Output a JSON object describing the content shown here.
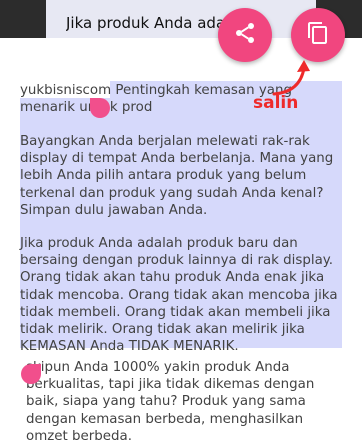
{
  "background_page": {
    "title_snippet": "Jika produk Anda adalah produk baru"
  },
  "article": {
    "p1": "yukbisniscom Pentingkah kemasan yang menarik untuk prod",
    "p2": "Bayangkan Anda berjalan melewati rak-rak display di tempat Anda berbelanja. Mana yang lebih Anda pilih antara produk yang belum terkenal dan produk yang sudah Anda kenal? Simpan dulu jawaban Anda.",
    "p3": "Jika produk Anda adalah produk baru dan bersaing dengan produk lainnya di rak display. Orang tidak akan tahu produk Anda enak jika tidak mencoba. Orang tidak akan mencoba jika tidak membeli. Orang tidak akan membeli jika tidak melirik. Orang tidak akan melirik jika KEMASAN Anda TIDAK MENARIK.",
    "p4": "skipun Anda 1000% yakin produk Anda berkualitas, tapi jika tidak dikemas dengan baik, siapa yang tahu? Produk yang sama dengan kemasan berbeda, menghasilkan omzet berbeda."
  },
  "actions": {
    "share_icon": "share-icon",
    "copy_icon": "copy-icon",
    "annotation": "salin"
  },
  "colors": {
    "accent": "#f1467f",
    "selection": "#d6d9fb",
    "annotation": "#ee2a2a"
  }
}
